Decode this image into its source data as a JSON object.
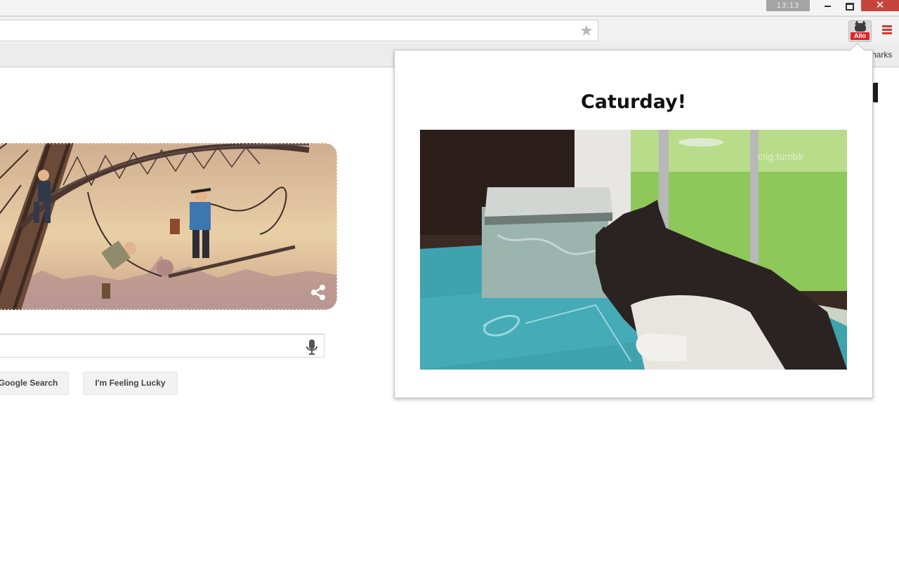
{
  "window": {
    "badge": "13:13",
    "close_glyph": "✕"
  },
  "toolbar": {
    "star_glyph": "★",
    "extension_badge": "Allo"
  },
  "bookmarks": {
    "partial_label": "harks"
  },
  "google": {
    "search_button": "Google Search",
    "lucky_button": "I'm Feeling Lucky"
  },
  "popup": {
    "title": "Caturday!",
    "watermark": "crig.tumblr"
  },
  "icons": {
    "star": "star-icon",
    "menu": "hamburger-menu-icon",
    "share": "share-icon",
    "mic": "microphone-icon"
  }
}
